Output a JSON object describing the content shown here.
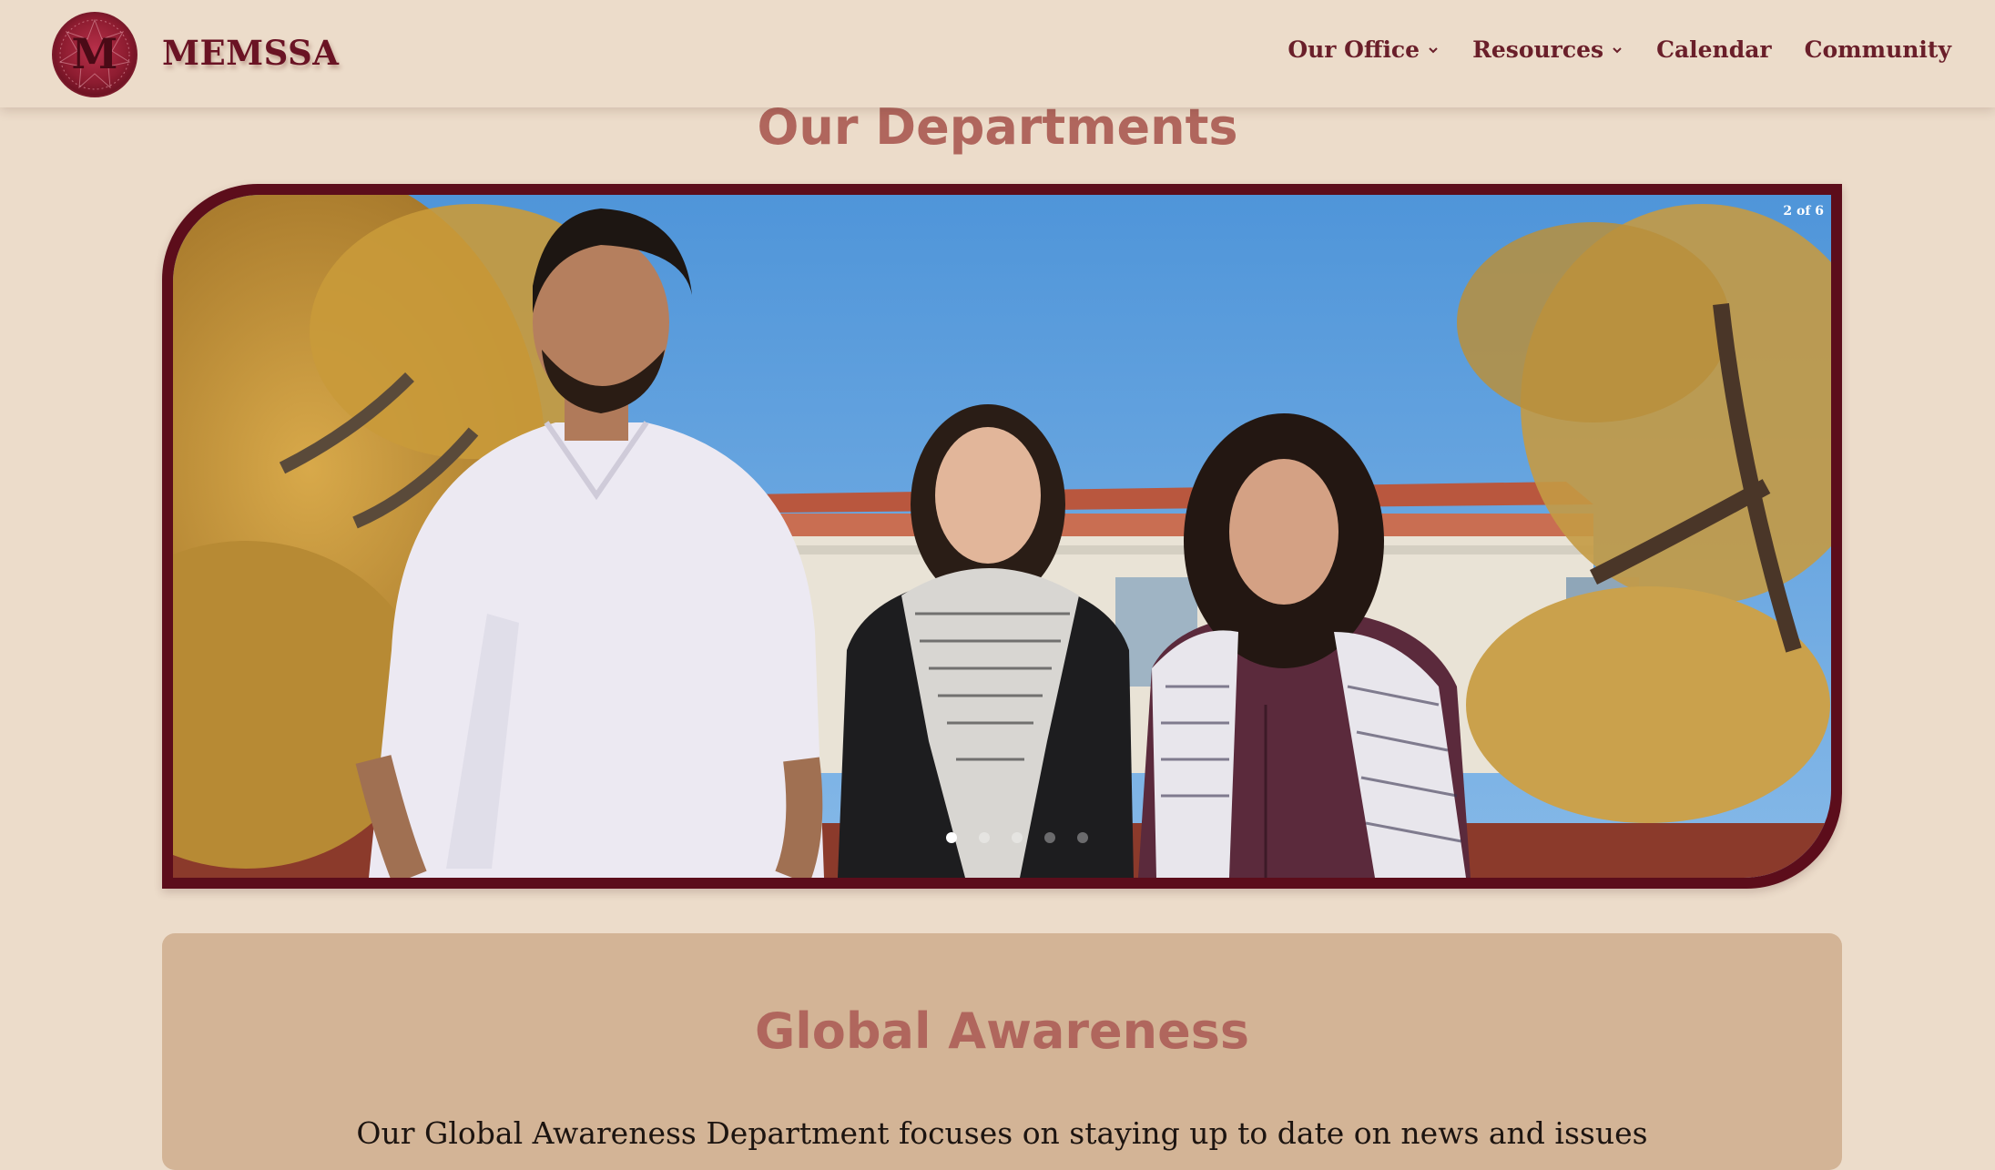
{
  "header": {
    "brand": "MEMSSA",
    "logo_letter": "M",
    "nav": [
      {
        "label": "Our Office",
        "has_dropdown": true
      },
      {
        "label": "Resources",
        "has_dropdown": true
      },
      {
        "label": "Calendar",
        "has_dropdown": false
      },
      {
        "label": "Community",
        "has_dropdown": false
      }
    ]
  },
  "departments": {
    "title": "Our Departments"
  },
  "slider": {
    "counter": "2 of 6",
    "dot_count": 5,
    "active_dot": 0,
    "frame_color": "#5c0d1b"
  },
  "card": {
    "title": "Global Awareness",
    "body": "Our Global Awareness Department focuses on staying up to date on news and issues"
  },
  "colors": {
    "page_bg": "#ecdcca",
    "brand": "#6a1324",
    "heading": "#b0665d",
    "card_bg": "#d3b496"
  }
}
